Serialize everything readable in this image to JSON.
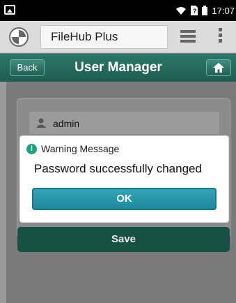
{
  "status_bar": {
    "time": "17:07",
    "icons": [
      "image-icon",
      "wifi-icon",
      "sim-icon",
      "battery-icon"
    ]
  },
  "app_bar": {
    "title": "FileHub Plus",
    "icons": [
      "app-logo-icon",
      "stack-icon",
      "kebab-menu-icon"
    ]
  },
  "nav_bar": {
    "back_label": "Back",
    "title": "User Manager",
    "home_icon": "home-icon"
  },
  "form": {
    "username_value": "admin",
    "save_label": "Save"
  },
  "dialog": {
    "title": "Warning Message",
    "message": "Password successfully changed",
    "ok_label": "OK",
    "icon": "exclamation-icon"
  },
  "colors": {
    "nav_green": "#2c7668",
    "save_green": "#175044",
    "ok_teal": "#2a97aa",
    "warn_green": "#1ea181"
  }
}
